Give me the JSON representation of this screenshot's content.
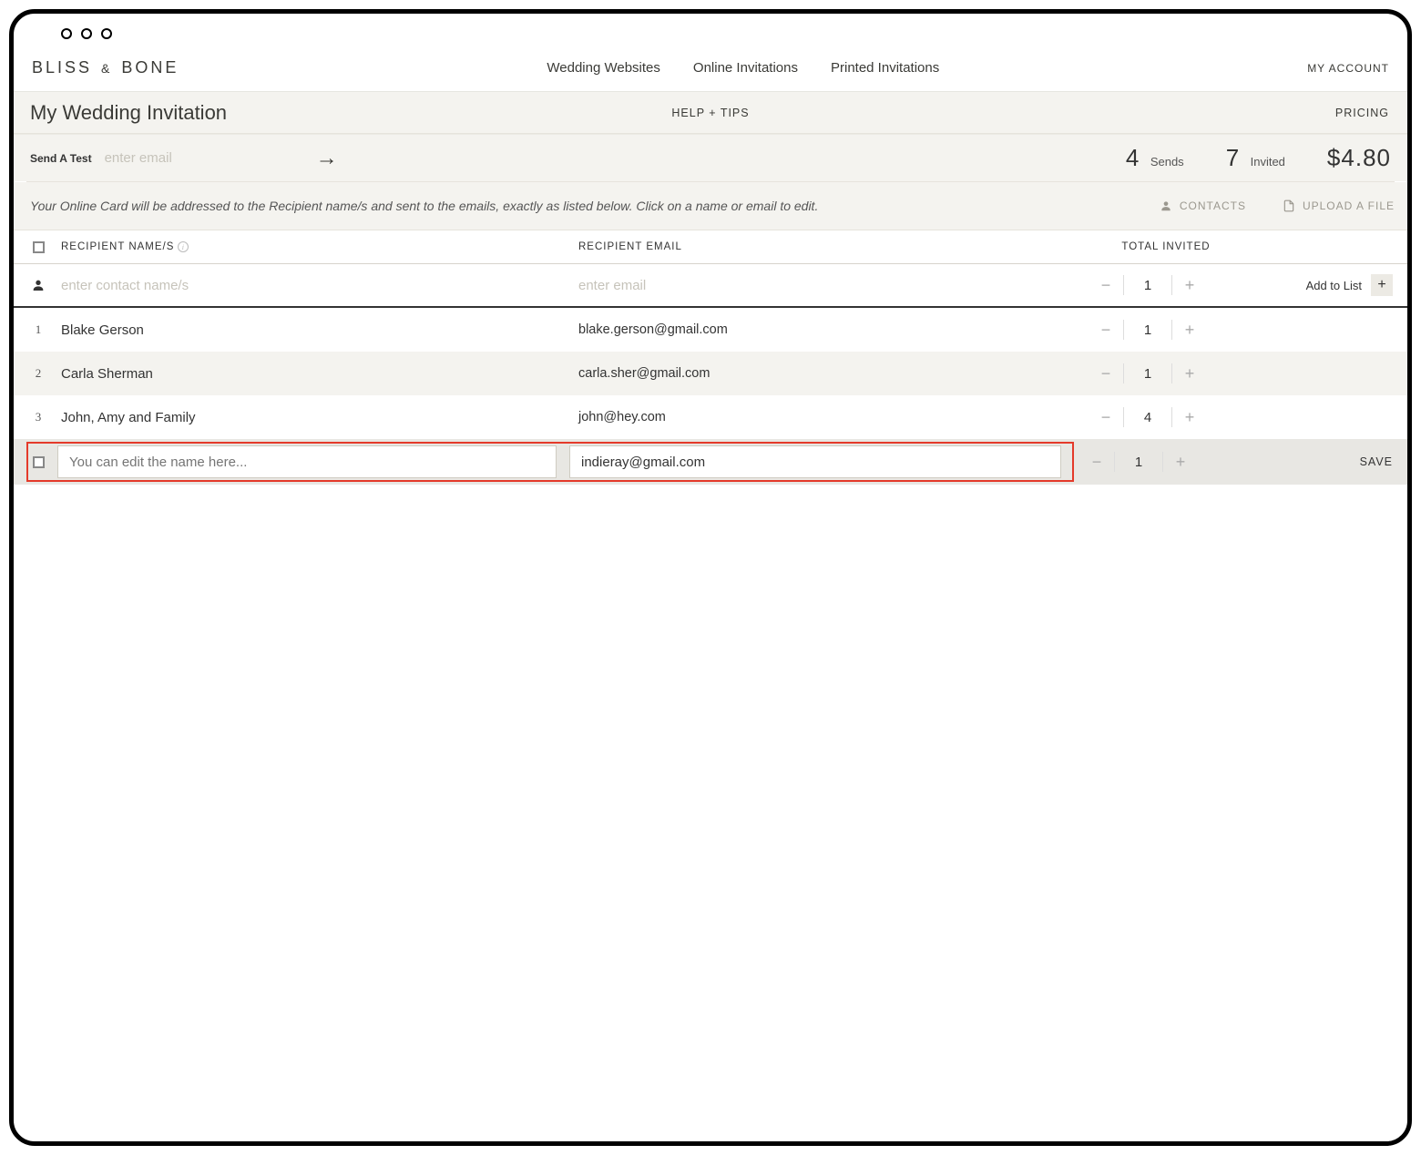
{
  "brand": {
    "left": "BLISS",
    "amp": "&",
    "right": "BONE"
  },
  "topnav": {
    "wedding": "Wedding Websites",
    "online": "Online Invitations",
    "printed": "Printed Invitations",
    "account": "MY ACCOUNT"
  },
  "subheader": {
    "title": "My Wedding Invitation",
    "help": "HELP + TIPS",
    "pricing": "PRICING"
  },
  "sendtest": {
    "label": "Send A Test",
    "placeholder": "enter email"
  },
  "stats": {
    "sends_num": "4",
    "sends_label": "Sends",
    "invited_num": "7",
    "invited_label": "Invited",
    "price": "$4.80"
  },
  "helprow": {
    "text": "Your Online Card will be addressed to the Recipient name/s and sent to the emails, exactly as listed below. Click on a name or email to edit.",
    "contacts": "CONTACTS",
    "upload": "UPLOAD A FILE"
  },
  "columns": {
    "name": "RECIPIENT NAME/S",
    "email": "RECIPIENT EMAIL",
    "total": "TOTAL INVITED"
  },
  "addrow": {
    "name_placeholder": "enter contact name/s",
    "email_placeholder": "enter email",
    "value": "1",
    "action": "Add to List"
  },
  "rows": [
    {
      "index": "1",
      "name": "Blake Gerson",
      "email": "blake.gerson@gmail.com",
      "count": "1"
    },
    {
      "index": "2",
      "name": "Carla Sherman",
      "email": "carla.sher@gmail.com",
      "count": "1"
    },
    {
      "index": "3",
      "name": "John, Amy and Family",
      "email": "john@hey.com",
      "count": "4"
    }
  ],
  "editrow": {
    "name_placeholder": "You can edit the name here...",
    "email_value": "indieray@gmail.com",
    "count": "1",
    "save": "SAVE"
  }
}
